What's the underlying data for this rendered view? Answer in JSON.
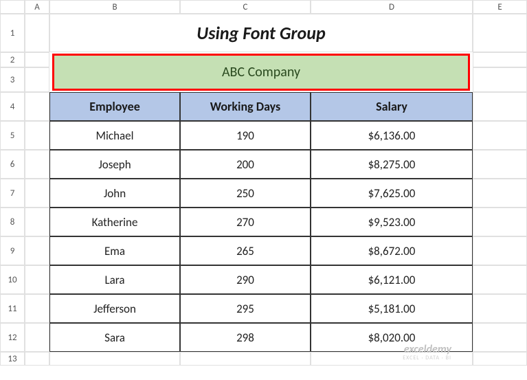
{
  "columns": [
    "A",
    "B",
    "C",
    "D",
    "E"
  ],
  "rows": [
    "1",
    "2",
    "3",
    "4",
    "5",
    "6",
    "7",
    "8",
    "9",
    "10",
    "11",
    "12",
    "13"
  ],
  "title": "Using Font Group",
  "company": "ABC Company",
  "headers": {
    "employee": "Employee",
    "working_days": "Working Days",
    "salary": "Salary"
  },
  "chart_data": {
    "type": "table",
    "columns": [
      "Employee",
      "Working Days",
      "Salary"
    ],
    "rows": [
      {
        "employee": "Michael",
        "working_days": "190",
        "salary": "$6,136.00"
      },
      {
        "employee": "Joseph",
        "working_days": "200",
        "salary": "$8,275.00"
      },
      {
        "employee": "John",
        "working_days": "250",
        "salary": "$7,625.00"
      },
      {
        "employee": "Katherine",
        "working_days": "270",
        "salary": "$9,523.00"
      },
      {
        "employee": "Ema",
        "working_days": "265",
        "salary": "$8,672.00"
      },
      {
        "employee": "Lara",
        "working_days": "290",
        "salary": "$6,121.00"
      },
      {
        "employee": "Jefferson",
        "working_days": "295",
        "salary": "$5,181.00"
      },
      {
        "employee": "Sara",
        "working_days": "298",
        "salary": "$8,020.00"
      }
    ]
  },
  "watermark": {
    "brand": "exceldemy",
    "sub": "EXCEL · DATA · BI"
  }
}
